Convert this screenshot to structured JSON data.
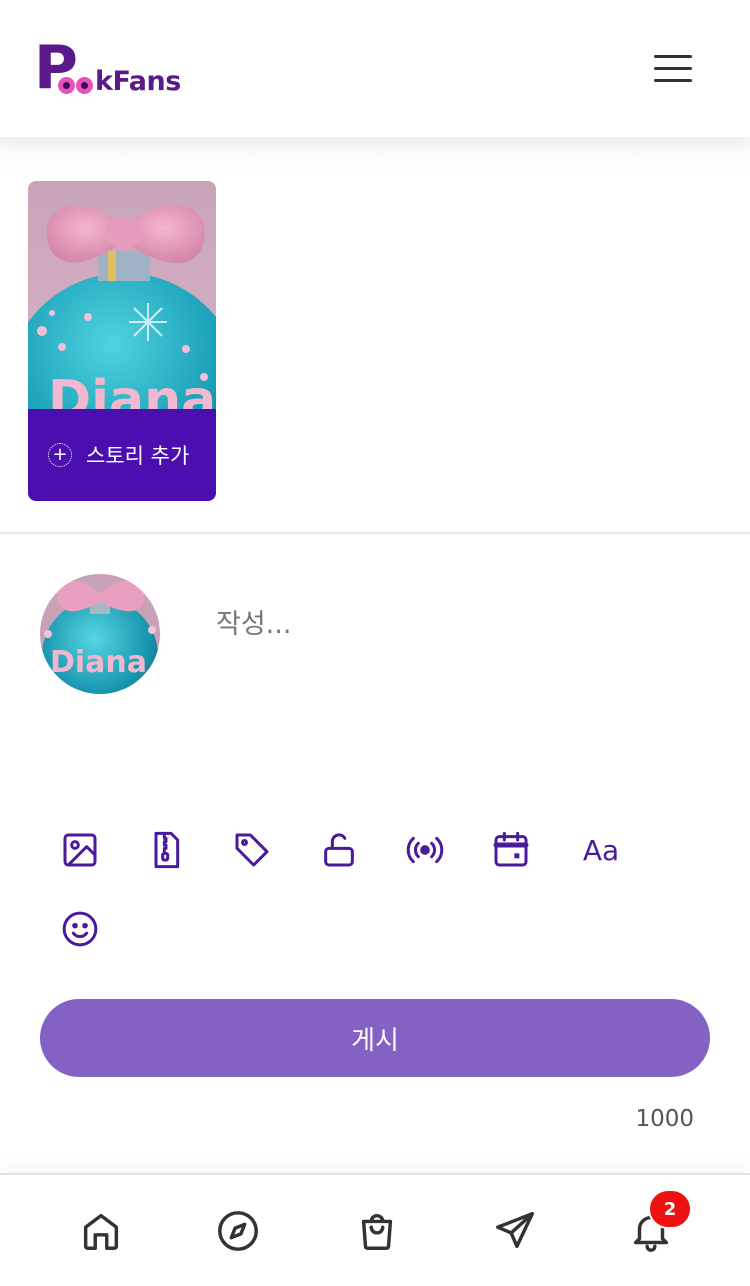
{
  "app": {
    "logo_letter": "P",
    "logo_rest": "kFans",
    "brand_color": "#5b1a8c",
    "accent_color": "#4a0fae"
  },
  "header": {
    "menu_icon": "hamburger-menu-icon"
  },
  "stories": {
    "add_story_label": "스토리 추가",
    "add_icon": "plus-circle-icon"
  },
  "composer": {
    "placeholder": "작성...",
    "tools": [
      {
        "name": "image-icon"
      },
      {
        "name": "zip-file-icon"
      },
      {
        "name": "tag-icon"
      },
      {
        "name": "unlock-icon"
      },
      {
        "name": "live-broadcast-icon"
      },
      {
        "name": "calendar-icon"
      },
      {
        "name": "text-format-icon",
        "label": "Aa"
      },
      {
        "name": "emoji-icon"
      }
    ],
    "post_label": "게시",
    "char_count": "1000",
    "post_button_color": "#8462c4"
  },
  "bottom_nav": {
    "items": [
      {
        "name": "home-icon"
      },
      {
        "name": "compass-icon"
      },
      {
        "name": "shopping-bag-icon"
      },
      {
        "name": "send-icon"
      },
      {
        "name": "bell-icon"
      }
    ],
    "notification_count": "2",
    "badge_color": "#ee1111"
  },
  "avatar_text": "Diana"
}
